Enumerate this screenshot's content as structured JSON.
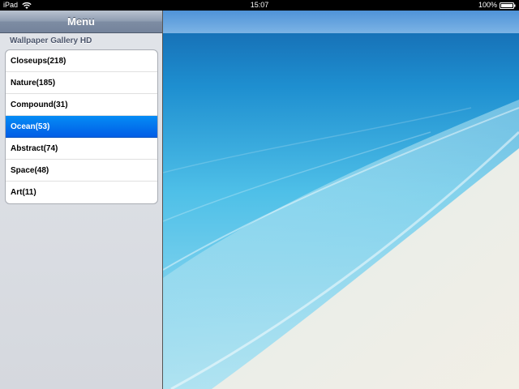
{
  "status_bar": {
    "device": "iPad",
    "time": "15:07",
    "battery": "100%"
  },
  "sidebar": {
    "title": "Menu",
    "section_header": "Wallpaper Gallery HD",
    "items": [
      {
        "label": "Closeups(218)"
      },
      {
        "label": "Nature(185)"
      },
      {
        "label": "Compound(31)"
      },
      {
        "label": "Ocean(53)",
        "selected": true
      },
      {
        "label": "Abstract(74)"
      },
      {
        "label": "Space(48)"
      },
      {
        "label": "Art(11)"
      }
    ]
  },
  "wallpaper": {
    "subject": "ocean-beach-image"
  },
  "colors": {
    "selected_row": "#0a74ea",
    "nav_bar": "#8d9bb0"
  }
}
